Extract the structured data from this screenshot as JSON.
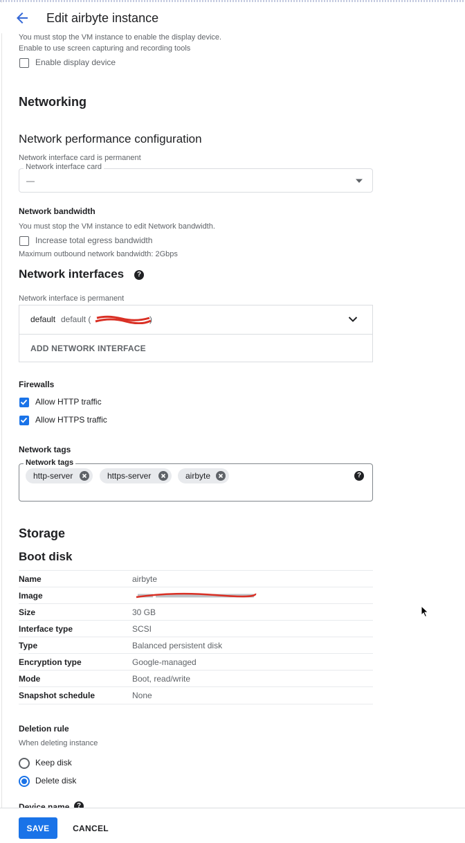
{
  "header": {
    "title": "Edit airbyte instance"
  },
  "display": {
    "stop_note": "You must stop the VM instance to enable the display device.",
    "enable_hint": "Enable to use screen capturing and recording tools",
    "checkbox_label": "Enable display device"
  },
  "networking": {
    "title": "Networking",
    "perf": {
      "title": "Network performance configuration",
      "nic_note": "Network interface card is permanent",
      "nic_label": "Network interface card",
      "nic_value": "—"
    },
    "bandwidth": {
      "title": "Network bandwidth",
      "stop_note": "You must stop the VM instance to edit Network bandwidth.",
      "checkbox_label": "Increase total egress bandwidth",
      "max_note": "Maximum outbound network bandwidth: 2Gbps"
    },
    "interfaces": {
      "title": "Network interfaces",
      "permanent_note": "Network interface is permanent",
      "row_name": "default",
      "row_detail_start": "default (",
      "row_detail_end": ")",
      "add_button": "ADD NETWORK INTERFACE"
    },
    "firewalls": {
      "title": "Firewalls",
      "http": "Allow HTTP traffic",
      "https": "Allow HTTPS traffic"
    },
    "tags": {
      "title": "Network tags",
      "field_label": "Network tags",
      "chips": [
        "http-server",
        "https-server",
        "airbyte"
      ]
    }
  },
  "storage": {
    "title": "Storage",
    "boot_disk_title": "Boot disk",
    "rows": [
      {
        "key": "Name",
        "value": "airbyte"
      },
      {
        "key": "Image",
        "value": ""
      },
      {
        "key": "Size",
        "value": "30 GB"
      },
      {
        "key": "Interface type",
        "value": "SCSI"
      },
      {
        "key": "Type",
        "value": "Balanced persistent disk"
      },
      {
        "key": "Encryption type",
        "value": "Google-managed"
      },
      {
        "key": "Mode",
        "value": "Boot, read/write"
      },
      {
        "key": "Snapshot schedule",
        "value": "None"
      }
    ],
    "deletion": {
      "title": "Deletion rule",
      "note": "When deleting instance",
      "keep": "Keep disk",
      "delete": "Delete disk"
    },
    "device_name": "Device name"
  },
  "footer": {
    "save": "SAVE",
    "cancel": "CANCEL"
  },
  "colors": {
    "accent": "#1a73e8",
    "redaction": "#d93025"
  }
}
